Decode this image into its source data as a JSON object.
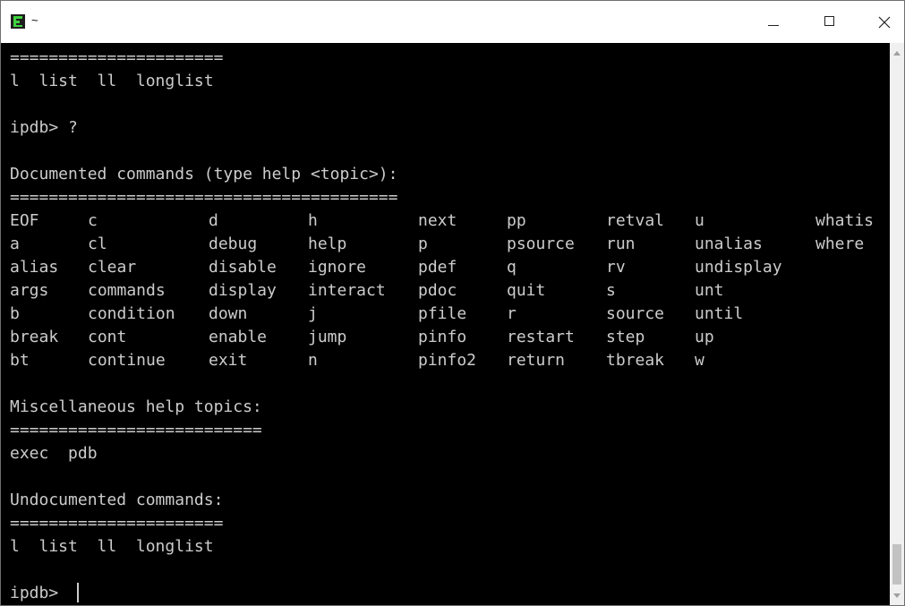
{
  "window": {
    "title": "~"
  },
  "terminal": {
    "top_rule": "======================",
    "top_list": "l  list  ll  longlist",
    "prompt_help": "ipdb> ?",
    "documented_header": "Documented commands (type help <topic>):",
    "documented_rule": "========================================",
    "commands_table": [
      [
        "EOF",
        "c",
        "d",
        "h",
        "next",
        "pp",
        "retval",
        "u",
        "whatis"
      ],
      [
        "a",
        "cl",
        "debug",
        "help",
        "p",
        "psource",
        "run",
        "unalias",
        "where"
      ],
      [
        "alias",
        "clear",
        "disable",
        "ignore",
        "pdef",
        "q",
        "rv",
        "undisplay",
        ""
      ],
      [
        "args",
        "commands",
        "display",
        "interact",
        "pdoc",
        "quit",
        "s",
        "unt",
        ""
      ],
      [
        "b",
        "condition",
        "down",
        "j",
        "pfile",
        "r",
        "source",
        "until",
        ""
      ],
      [
        "break",
        "cont",
        "enable",
        "jump",
        "pinfo",
        "restart",
        "step",
        "up",
        ""
      ],
      [
        "bt",
        "continue",
        "exit",
        "n",
        "pinfo2",
        "return",
        "tbreak",
        "w",
        ""
      ]
    ],
    "misc_header": "Miscellaneous help topics:",
    "misc_rule": "==========================",
    "misc_list": "exec  pdb",
    "undoc_header": "Undocumented commands:",
    "undoc_rule": "======================",
    "undoc_list": "l  list  ll  longlist",
    "current_prompt": "ipdb> "
  },
  "colors": {
    "terminal_bg": "#000000",
    "terminal_fg": "#cccccc",
    "titlebar_bg": "#ffffff"
  }
}
